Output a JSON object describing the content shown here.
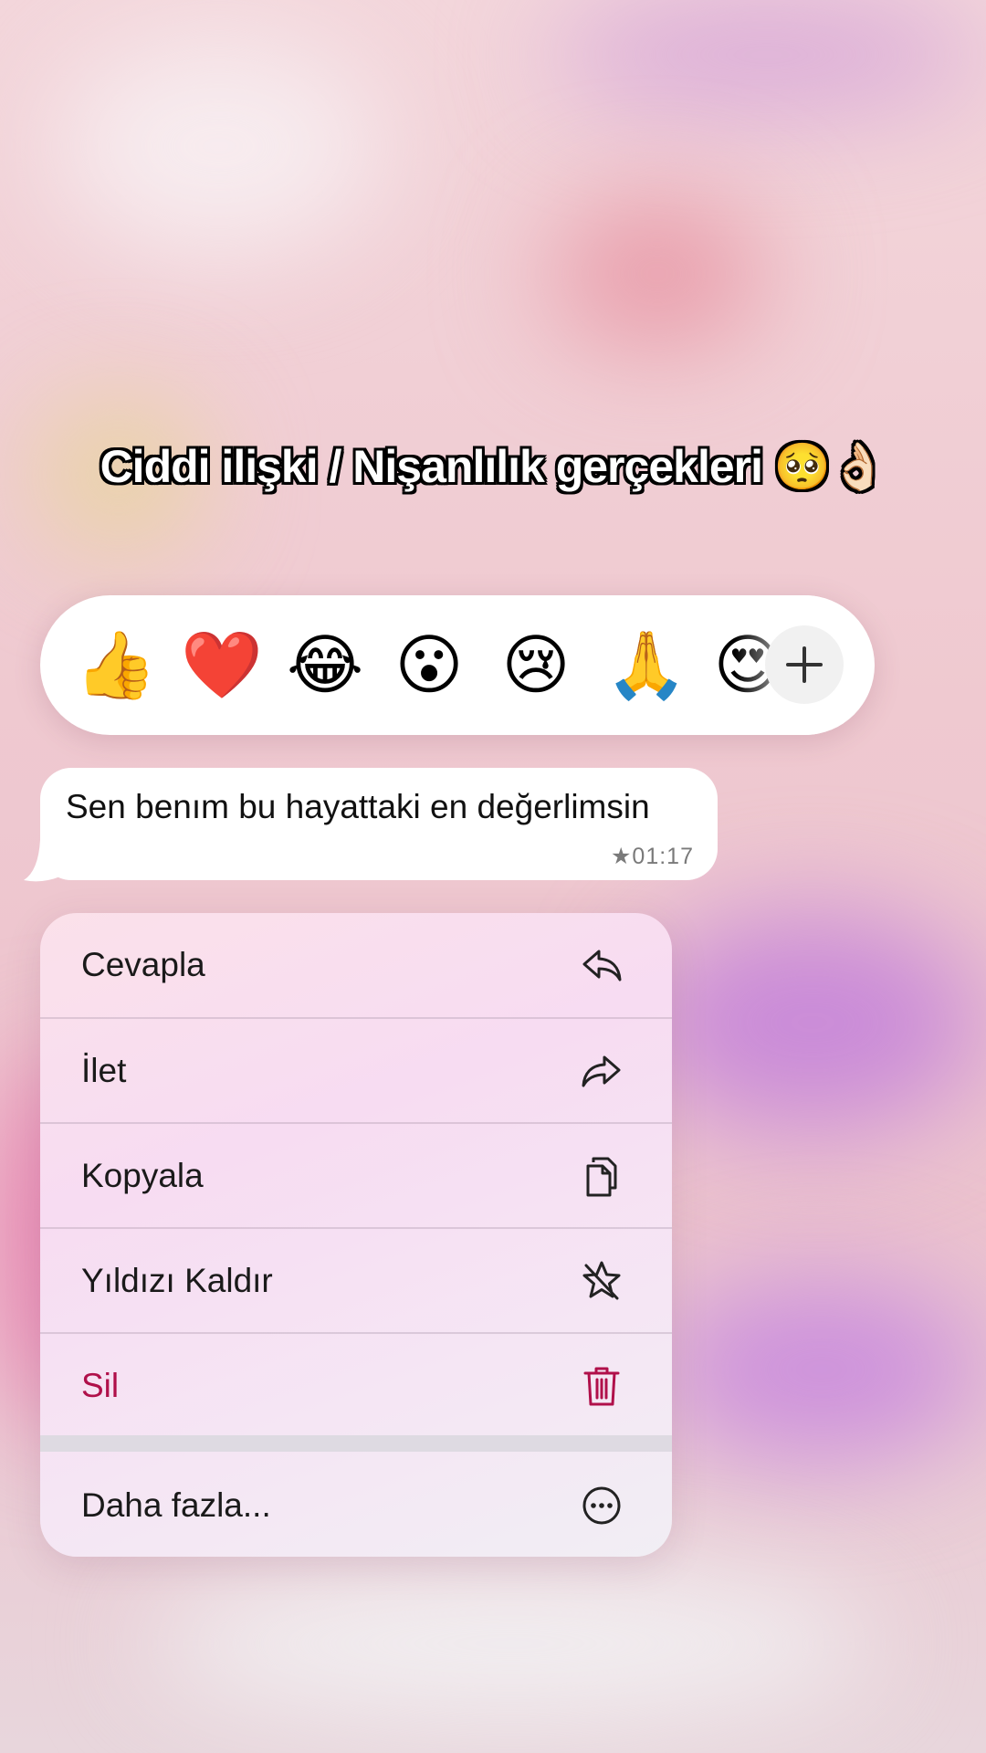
{
  "caption": {
    "text": "Ciddi ilişki / Nişanlılık gerçekleri",
    "emoji": "🥺👌🏻"
  },
  "reactions": {
    "items": [
      {
        "emoji": "👍",
        "name": "thumbs-up"
      },
      {
        "emoji": "❤️",
        "name": "red-heart"
      },
      {
        "emoji": "😂",
        "name": "tears-of-joy"
      },
      {
        "emoji": "😮",
        "name": "open-mouth"
      },
      {
        "emoji": "😢",
        "name": "crying-face"
      },
      {
        "emoji": "🙏",
        "name": "folded-hands"
      },
      {
        "emoji": "😍",
        "name": "heart-eyes"
      }
    ],
    "more_icon": "plus-icon"
  },
  "message": {
    "text": "Sen benım bu hayattaki en değerlimsin",
    "time": "★01:17"
  },
  "menu": {
    "items": [
      {
        "label": "Cevapla",
        "icon": "reply-icon"
      },
      {
        "label": "İlet",
        "icon": "forward-icon"
      },
      {
        "label": "Kopyala",
        "icon": "copy-icon"
      },
      {
        "label": "Yıldızı Kaldır",
        "icon": "unstar-icon"
      },
      {
        "label": "Sil",
        "icon": "trash-icon"
      },
      {
        "label": "Daha fazla...",
        "icon": "more-icon"
      }
    ]
  },
  "colors": {
    "danger": "#b0104a",
    "bubble": "#ffffff",
    "menu_bg": "#f7dcf2"
  }
}
